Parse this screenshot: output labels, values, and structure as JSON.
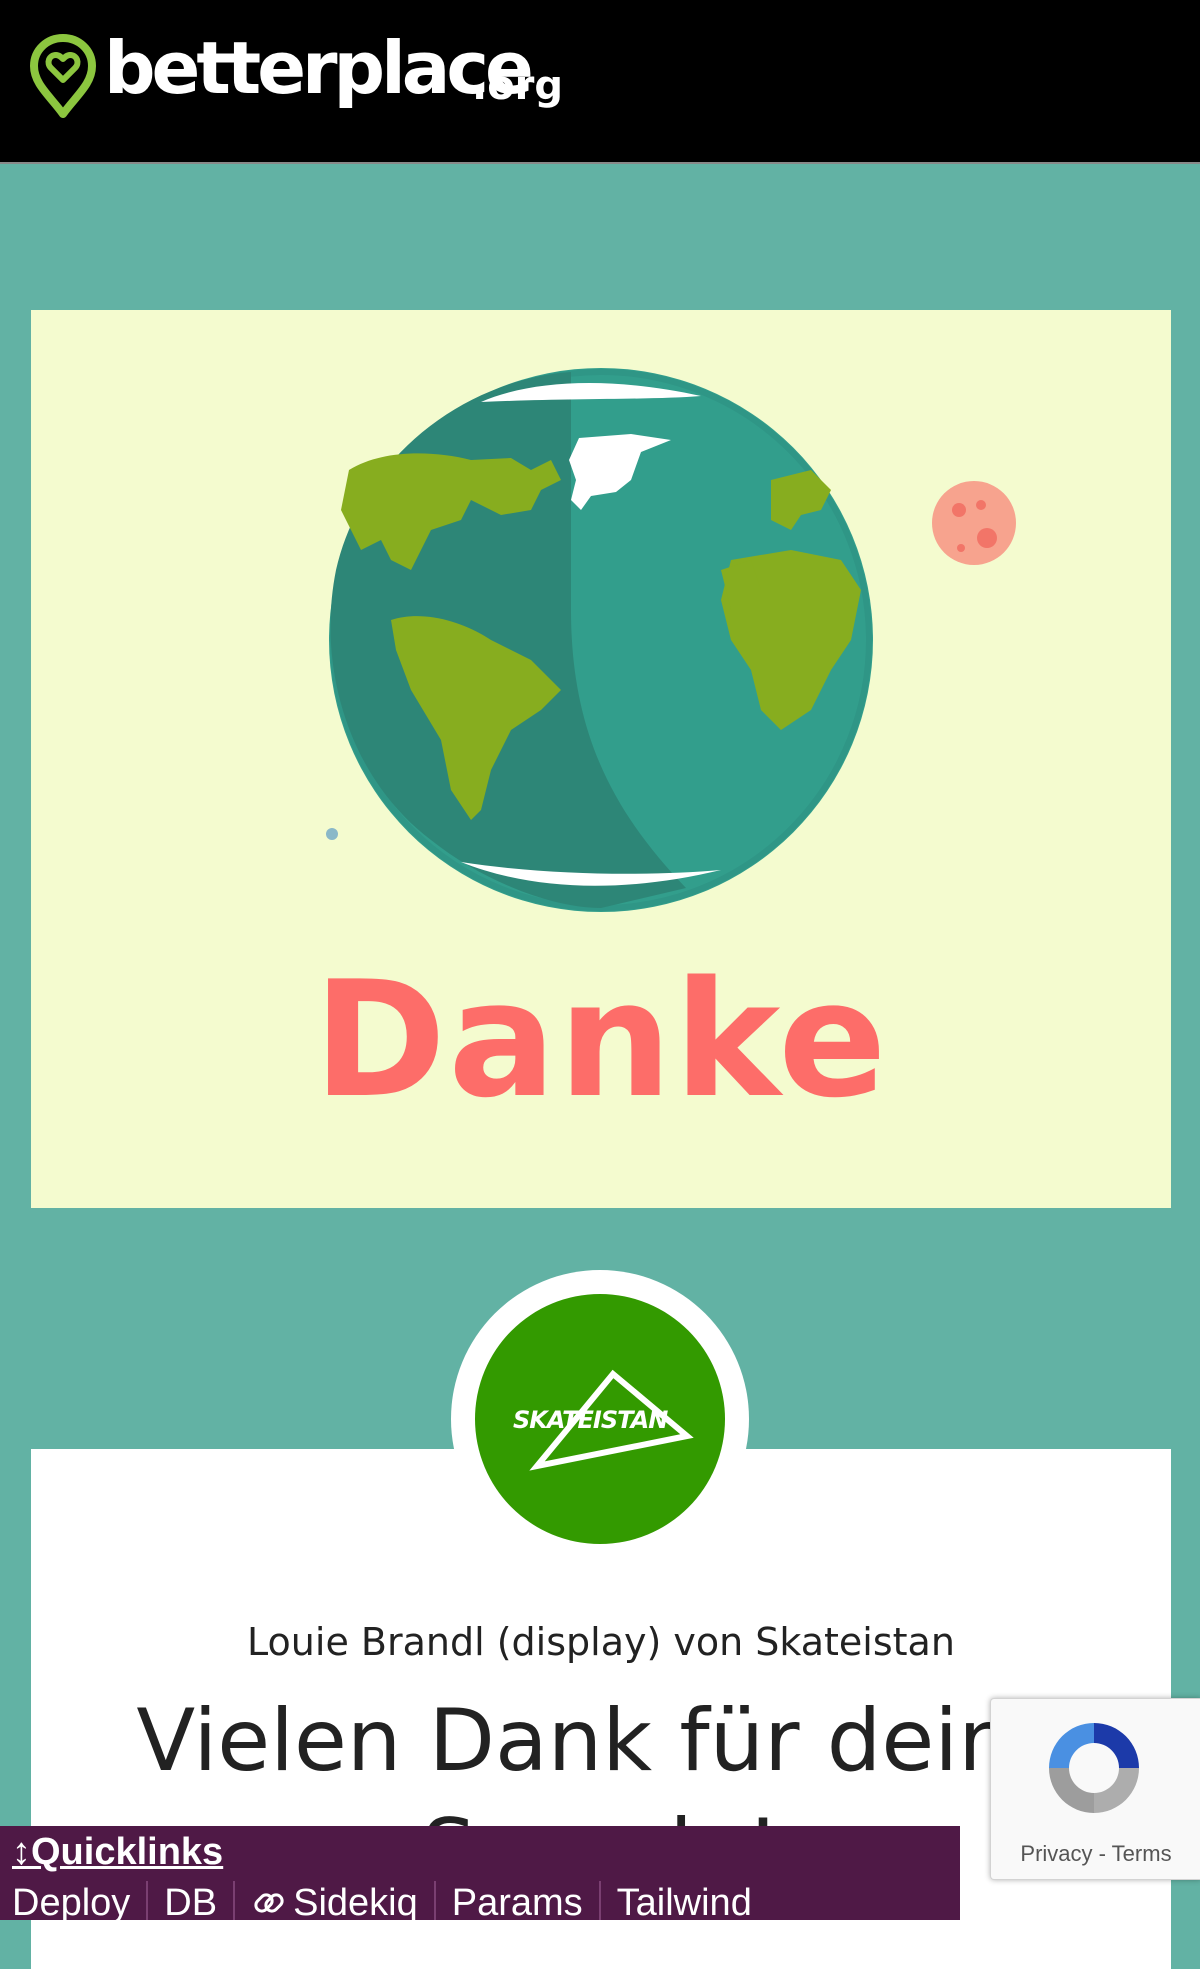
{
  "header": {
    "logo_text": "betterplace",
    "logo_suffix": ".org",
    "logo_icon": "pin-heart-icon"
  },
  "hero": {
    "title": "Danke",
    "illustration": "earth-globe-illustration"
  },
  "project": {
    "avatar_text": "SKATEISTAN",
    "donor_line": "Louie Brandl (display) von Skateistan",
    "thanks_line1": "Vielen Dank für deine",
    "thanks_line2": "Spende!"
  },
  "recaptcha": {
    "links": "Privacy - Terms"
  },
  "quicklinks": {
    "title": "↕Quicklinks",
    "items": [
      "Deploy",
      "DB",
      "Sidekiq",
      "Params",
      "Tailwind"
    ]
  },
  "colors": {
    "brand_green": "#8cc63f",
    "hero_bg": "#f4fbcf",
    "danke": "#fd6d69",
    "page_bg": "#62b2a4",
    "quicklinks_bg": "#4f1946",
    "avatar_bg": "#339a00"
  }
}
